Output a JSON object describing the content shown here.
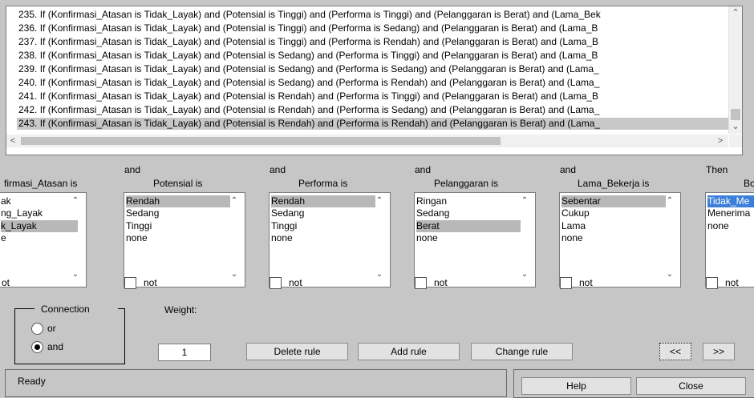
{
  "rules": [
    "235. If (Konfirmasi_Atasan is Tidak_Layak) and (Potensial is Tinggi) and (Performa is Tinggi) and (Pelanggaran is Berat) and (Lama_Bek",
    "236. If (Konfirmasi_Atasan is Tidak_Layak) and (Potensial is Tinggi) and (Performa is Sedang) and (Pelanggaran is Berat) and (Lama_B",
    "237. If (Konfirmasi_Atasan is Tidak_Layak) and (Potensial is Tinggi) and (Performa is Rendah) and (Pelanggaran is Berat) and (Lama_B",
    "238. If (Konfirmasi_Atasan is Tidak_Layak) and (Potensial is Sedang) and (Performa is Tinggi) and (Pelanggaran is Berat) and (Lama_B",
    "239. If (Konfirmasi_Atasan is Tidak_Layak) and (Potensial is Sedang) and (Performa is Sedang) and (Pelanggaran is Berat) and (Lama_",
    "240. If (Konfirmasi_Atasan is Tidak_Layak) and (Potensial is Sedang) and (Performa is Rendah) and (Pelanggaran is Berat) and (Lama_",
    "241. If (Konfirmasi_Atasan is Tidak_Layak) and (Potensial is Rendah) and (Performa is Tinggi) and (Pelanggaran is Berat) and (Lama_B",
    "242. If (Konfirmasi_Atasan is Tidak_Layak) and (Potensial is Rendah) and (Performa is Sedang) and (Pelanggaran is Berat) and (Lama_",
    "243. If (Konfirmasi_Atasan is Tidak_Layak) and (Potensial is Rendah) and (Performa is Rendah) and (Pelanggaran is Berat) and (Lama_"
  ],
  "selected_rule_index": 8,
  "columns": {
    "c1": {
      "title": "firmasi_Atasan is",
      "options": [
        "ak",
        "ng_Layak",
        "k_Layak",
        "e"
      ],
      "selected": 2,
      "not_label": "ot"
    },
    "c2": {
      "and_label": "and",
      "title": "Potensial is",
      "options": [
        "Rendah",
        "Sedang",
        "Tinggi",
        "none"
      ],
      "selected": 0,
      "not_label": "not"
    },
    "c3": {
      "and_label": "and",
      "title": "Performa is",
      "options": [
        "Rendah",
        "Sedang",
        "Tinggi",
        "none"
      ],
      "selected": 0,
      "not_label": "not"
    },
    "c4": {
      "and_label": "and",
      "title": "Pelanggaran is",
      "options": [
        "Ringan",
        "Sedang",
        "Berat",
        "none"
      ],
      "selected": 2,
      "not_label": "not"
    },
    "c5": {
      "and_label": "and",
      "title": "Lama_Bekerja is",
      "options": [
        "Sebentar",
        "Cukup",
        "Lama",
        "none"
      ],
      "selected": 0,
      "not_label": "not"
    },
    "c6": {
      "and_label": "Then",
      "title": "Bo",
      "options": [
        "Tidak_Me",
        "Menerima",
        "none"
      ],
      "selected": 0,
      "not_label": "not"
    }
  },
  "connection": {
    "title": "Connection",
    "or_label": "or",
    "and_label": "and",
    "selected": "and"
  },
  "weight": {
    "label": "Weight:",
    "value": "1"
  },
  "buttons": {
    "delete": "Delete rule",
    "add": "Add rule",
    "change": "Change rule",
    "prev": "<<",
    "next": ">>",
    "help": "Help",
    "close": "Close"
  },
  "status": "Ready"
}
